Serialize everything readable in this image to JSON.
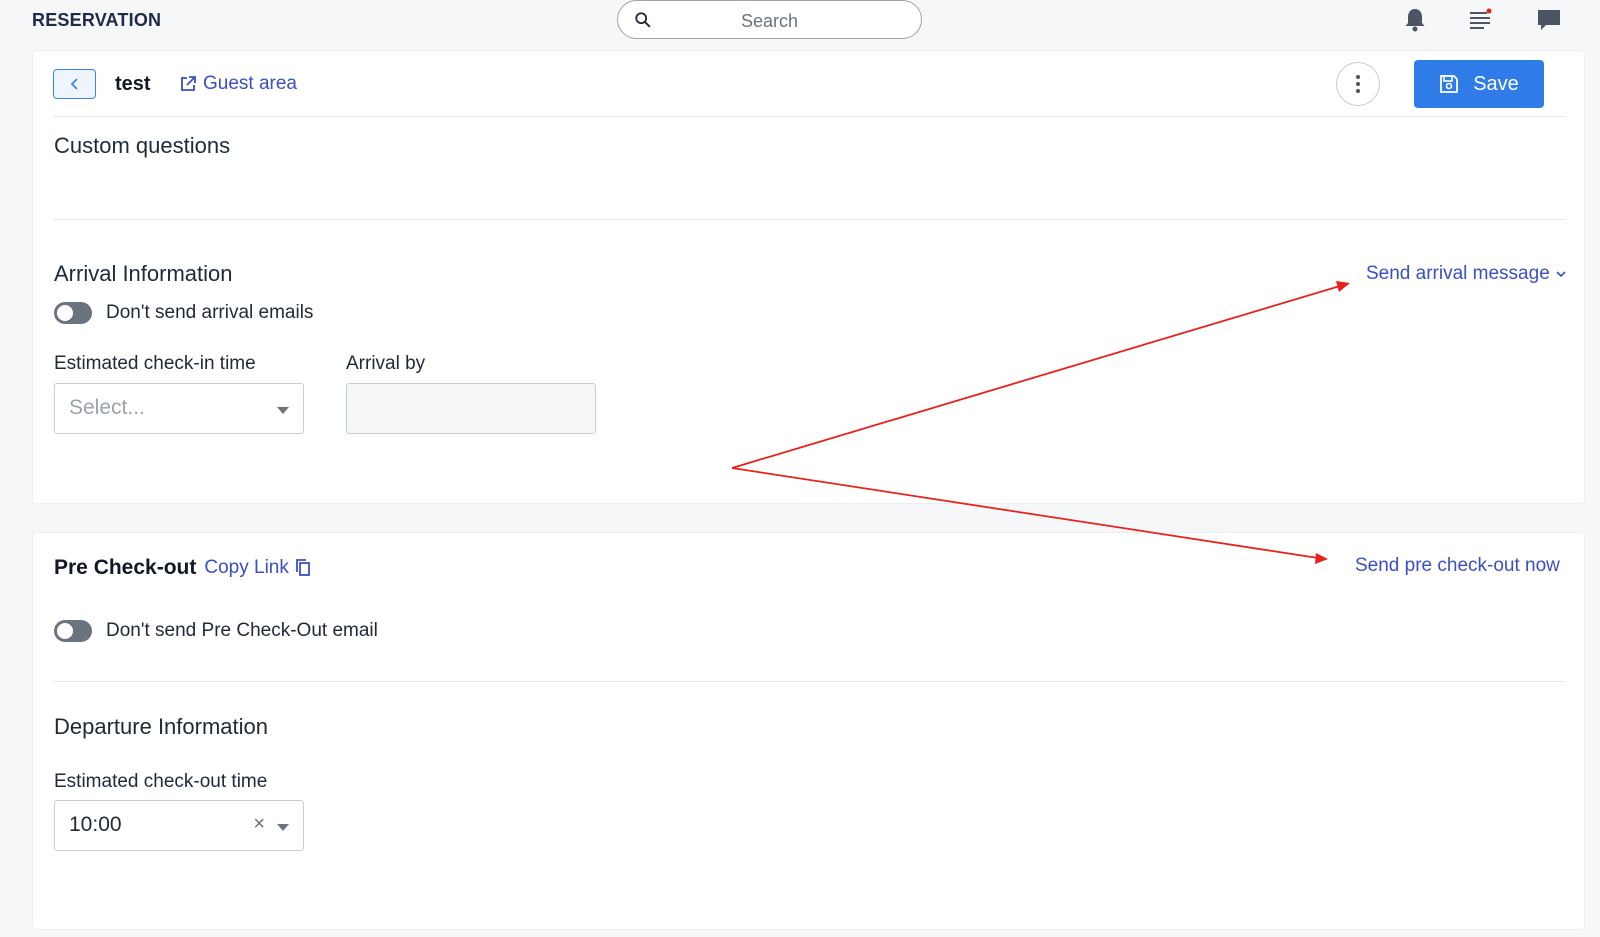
{
  "topbar": {
    "brand": "RESERVATION",
    "search_placeholder": "Search"
  },
  "header": {
    "reservation_name": "test",
    "guest_area_label": "Guest area",
    "save_label": "Save"
  },
  "custom_questions": {
    "title": "Custom questions"
  },
  "arrival": {
    "title": "Arrival Information",
    "toggle_label": "Don't send arrival emails",
    "checkin_label": "Estimated check-in time",
    "checkin_placeholder": "Select...",
    "arrival_by_label": "Arrival by",
    "arrival_by_value": "",
    "send_message_label": "Send arrival message"
  },
  "pre_checkout": {
    "title": "Pre Check-out",
    "copy_link_label": "Copy Link",
    "send_now_label": "Send pre check-out now",
    "toggle_label": "Don't send Pre Check-Out email"
  },
  "departure": {
    "title": "Departure Information",
    "checkout_label": "Estimated check-out time",
    "checkout_value": "10:00"
  },
  "colors": {
    "accent": "#2f7be8",
    "link": "#3b4fc4",
    "annotation": "#e8221b"
  }
}
